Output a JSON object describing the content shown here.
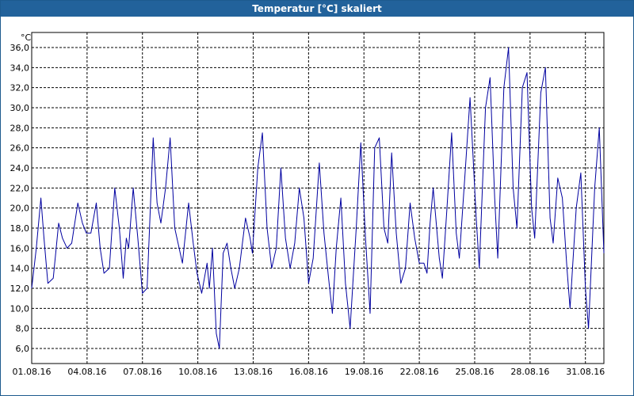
{
  "window": {
    "title": "Temperatur [°C] skaliert"
  },
  "colors": {
    "titlebar": "#22629b",
    "series": "#0000a0",
    "grid": "#000000"
  },
  "chart_data": {
    "type": "line",
    "title": "Temperatur [°C] skaliert",
    "ylabel": "°C",
    "xlabel": "",
    "ylim": [
      4.5,
      37.5
    ],
    "xlim": [
      "2016-08-01",
      "2016-09-01"
    ],
    "grid": true,
    "yticks": [
      {
        "value": 6,
        "label": "6,0"
      },
      {
        "value": 8,
        "label": "8,0"
      },
      {
        "value": 10,
        "label": "10,0"
      },
      {
        "value": 12,
        "label": "12,0"
      },
      {
        "value": 14,
        "label": "14,0"
      },
      {
        "value": 16,
        "label": "16,0"
      },
      {
        "value": 18,
        "label": "18,0"
      },
      {
        "value": 20,
        "label": "20,0"
      },
      {
        "value": 22,
        "label": "22,0"
      },
      {
        "value": 24,
        "label": "24,0"
      },
      {
        "value": 26,
        "label": "26,0"
      },
      {
        "value": 28,
        "label": "28,0"
      },
      {
        "value": 30,
        "label": "30,0"
      },
      {
        "value": 32,
        "label": "32,0"
      },
      {
        "value": 34,
        "label": "34,0"
      },
      {
        "value": 36,
        "label": "36,0"
      }
    ],
    "xticks": [
      {
        "value": "2016-08-01",
        "label": "01.08.16"
      },
      {
        "value": "2016-08-04",
        "label": "04.08.16"
      },
      {
        "value": "2016-08-07",
        "label": "07.08.16"
      },
      {
        "value": "2016-08-10",
        "label": "10.08.16"
      },
      {
        "value": "2016-08-13",
        "label": "13.08.16"
      },
      {
        "value": "2016-08-16",
        "label": "16.08.16"
      },
      {
        "value": "2016-08-19",
        "label": "19.08.16"
      },
      {
        "value": "2016-08-22",
        "label": "22.08.16"
      },
      {
        "value": "2016-08-25",
        "label": "25.08.16"
      },
      {
        "value": "2016-08-28",
        "label": "28.08.16"
      },
      {
        "value": "2016-08-31",
        "label": "31.08.16"
      }
    ],
    "series": [
      {
        "points": [
          [
            "2016-08-01 00:00",
            12.0
          ],
          [
            "2016-08-01 06:00",
            16.0
          ],
          [
            "2016-08-01 12:00",
            21.0
          ],
          [
            "2016-08-01 16:00",
            17.0
          ],
          [
            "2016-08-01 21:00",
            12.5
          ],
          [
            "2016-08-02 04:00",
            13.0
          ],
          [
            "2016-08-02 11:00",
            18.5
          ],
          [
            "2016-08-02 16:00",
            17.0
          ],
          [
            "2016-08-02 22:00",
            16.0
          ],
          [
            "2016-08-03 04:00",
            16.5
          ],
          [
            "2016-08-03 12:00",
            20.5
          ],
          [
            "2016-08-03 18:00",
            18.5
          ],
          [
            "2016-08-03 23:00",
            17.5
          ],
          [
            "2016-08-04 05:00",
            17.5
          ],
          [
            "2016-08-04 12:00",
            20.5
          ],
          [
            "2016-08-04 17:00",
            16.0
          ],
          [
            "2016-08-04 22:00",
            13.5
          ],
          [
            "2016-08-05 05:00",
            14.0
          ],
          [
            "2016-08-05 12:00",
            22.0
          ],
          [
            "2016-08-05 18:00",
            18.0
          ],
          [
            "2016-08-05 23:00",
            13.0
          ],
          [
            "2016-08-06 03:00",
            17.0
          ],
          [
            "2016-08-06 06:00",
            16.0
          ],
          [
            "2016-08-06 12:00",
            22.0
          ],
          [
            "2016-08-06 18:00",
            17.0
          ],
          [
            "2016-08-07 00:00",
            11.5
          ],
          [
            "2016-08-07 06:00",
            12.0
          ],
          [
            "2016-08-07 14:00",
            27.0
          ],
          [
            "2016-08-07 19:00",
            20.5
          ],
          [
            "2016-08-08 00:00",
            18.5
          ],
          [
            "2016-08-08 06:00",
            22.0
          ],
          [
            "2016-08-08 12:00",
            27.0
          ],
          [
            "2016-08-08 18:00",
            18.0
          ],
          [
            "2016-08-09 04:00",
            14.5
          ],
          [
            "2016-08-09 12:00",
            20.5
          ],
          [
            "2016-08-09 18:00",
            16.5
          ],
          [
            "2016-08-09 23:00",
            13.5
          ],
          [
            "2016-08-10 05:00",
            11.5
          ],
          [
            "2016-08-10 12:00",
            14.5
          ],
          [
            "2016-08-10 15:00",
            12.0
          ],
          [
            "2016-08-10 19:00",
            16.0
          ],
          [
            "2016-08-11 00:00",
            7.5
          ],
          [
            "2016-08-11 04:00",
            6.0
          ],
          [
            "2016-08-11 09:00",
            15.5
          ],
          [
            "2016-08-11 14:00",
            16.5
          ],
          [
            "2016-08-11 19:00",
            14.0
          ],
          [
            "2016-08-12 00:00",
            12.0
          ],
          [
            "2016-08-12 06:00",
            14.0
          ],
          [
            "2016-08-12 14:00",
            19.0
          ],
          [
            "2016-08-12 20:00",
            17.0
          ],
          [
            "2016-08-12 23:00",
            15.5
          ],
          [
            "2016-08-13 06:00",
            24.0
          ],
          [
            "2016-08-13 12:00",
            27.5
          ],
          [
            "2016-08-13 18:00",
            18.0
          ],
          [
            "2016-08-14 00:00",
            14.0
          ],
          [
            "2016-08-14 06:00",
            16.0
          ],
          [
            "2016-08-14 12:00",
            24.0
          ],
          [
            "2016-08-14 18:00",
            17.0
          ],
          [
            "2016-08-15 00:00",
            14.0
          ],
          [
            "2016-08-15 06:00",
            16.5
          ],
          [
            "2016-08-15 12:00",
            22.0
          ],
          [
            "2016-08-15 18:00",
            19.0
          ],
          [
            "2016-08-16 00:00",
            12.5
          ],
          [
            "2016-08-16 06:00",
            15.0
          ],
          [
            "2016-08-16 14:00",
            24.5
          ],
          [
            "2016-08-16 20:00",
            17.5
          ],
          [
            "2016-08-17 02:00",
            13.0
          ],
          [
            "2016-08-17 07:00",
            9.5
          ],
          [
            "2016-08-17 12:00",
            16.0
          ],
          [
            "2016-08-17 18:00",
            21.0
          ],
          [
            "2016-08-18 00:00",
            12.5
          ],
          [
            "2016-08-18 06:00",
            8.0
          ],
          [
            "2016-08-18 14:00",
            18.0
          ],
          [
            "2016-08-18 20:00",
            26.5
          ],
          [
            "2016-08-19 02:00",
            17.0
          ],
          [
            "2016-08-19 08:00",
            9.5
          ],
          [
            "2016-08-19 14:00",
            26.0
          ],
          [
            "2016-08-19 20:00",
            27.0
          ],
          [
            "2016-08-20 02:00",
            18.0
          ],
          [
            "2016-08-20 07:00",
            16.5
          ],
          [
            "2016-08-20 12:00",
            25.5
          ],
          [
            "2016-08-20 18:00",
            17.5
          ],
          [
            "2016-08-21 00:00",
            12.5
          ],
          [
            "2016-08-21 06:00",
            14.0
          ],
          [
            "2016-08-21 12:00",
            20.5
          ],
          [
            "2016-08-21 18:00",
            17.0
          ],
          [
            "2016-08-22 00:00",
            14.5
          ],
          [
            "2016-08-22 06:00",
            14.5
          ],
          [
            "2016-08-22 10:00",
            13.5
          ],
          [
            "2016-08-22 14:00",
            18.5
          ],
          [
            "2016-08-22 18:00",
            22.0
          ],
          [
            "2016-08-23 02:00",
            15.0
          ],
          [
            "2016-08-23 06:00",
            13.0
          ],
          [
            "2016-08-23 12:00",
            20.0
          ],
          [
            "2016-08-23 18:00",
            27.5
          ],
          [
            "2016-08-24 00:00",
            17.5
          ],
          [
            "2016-08-24 04:00",
            15.0
          ],
          [
            "2016-08-24 12:00",
            24.0
          ],
          [
            "2016-08-24 18:00",
            31.0
          ],
          [
            "2016-08-25 02:00",
            19.0
          ],
          [
            "2016-08-25 06:00",
            14.0
          ],
          [
            "2016-08-25 14:00",
            30.0
          ],
          [
            "2016-08-25 20:00",
            33.0
          ],
          [
            "2016-08-26 02:00",
            21.0
          ],
          [
            "2016-08-26 06:00",
            15.0
          ],
          [
            "2016-08-26 14:00",
            32.0
          ],
          [
            "2016-08-26 20:00",
            36.0
          ],
          [
            "2016-08-27 02:00",
            22.0
          ],
          [
            "2016-08-27 07:00",
            18.0
          ],
          [
            "2016-08-27 14:00",
            32.0
          ],
          [
            "2016-08-27 20:00",
            33.5
          ],
          [
            "2016-08-28 02:00",
            20.0
          ],
          [
            "2016-08-28 06:00",
            17.0
          ],
          [
            "2016-08-28 14:00",
            31.5
          ],
          [
            "2016-08-28 20:00",
            34.0
          ],
          [
            "2016-08-29 02:00",
            19.0
          ],
          [
            "2016-08-29 06:00",
            16.5
          ],
          [
            "2016-08-29 12:00",
            23.0
          ],
          [
            "2016-08-29 18:00",
            21.0
          ],
          [
            "2016-08-30 00:00",
            14.0
          ],
          [
            "2016-08-30 04:00",
            10.0
          ],
          [
            "2016-08-30 12:00",
            20.0
          ],
          [
            "2016-08-30 18:00",
            23.5
          ],
          [
            "2016-08-31 00:00",
            12.0
          ],
          [
            "2016-08-31 04:00",
            8.0
          ],
          [
            "2016-08-31 12:00",
            22.0
          ],
          [
            "2016-08-31 18:00",
            28.0
          ],
          [
            "2016-09-01 00:00",
            15.5
          ]
        ]
      }
    ]
  }
}
